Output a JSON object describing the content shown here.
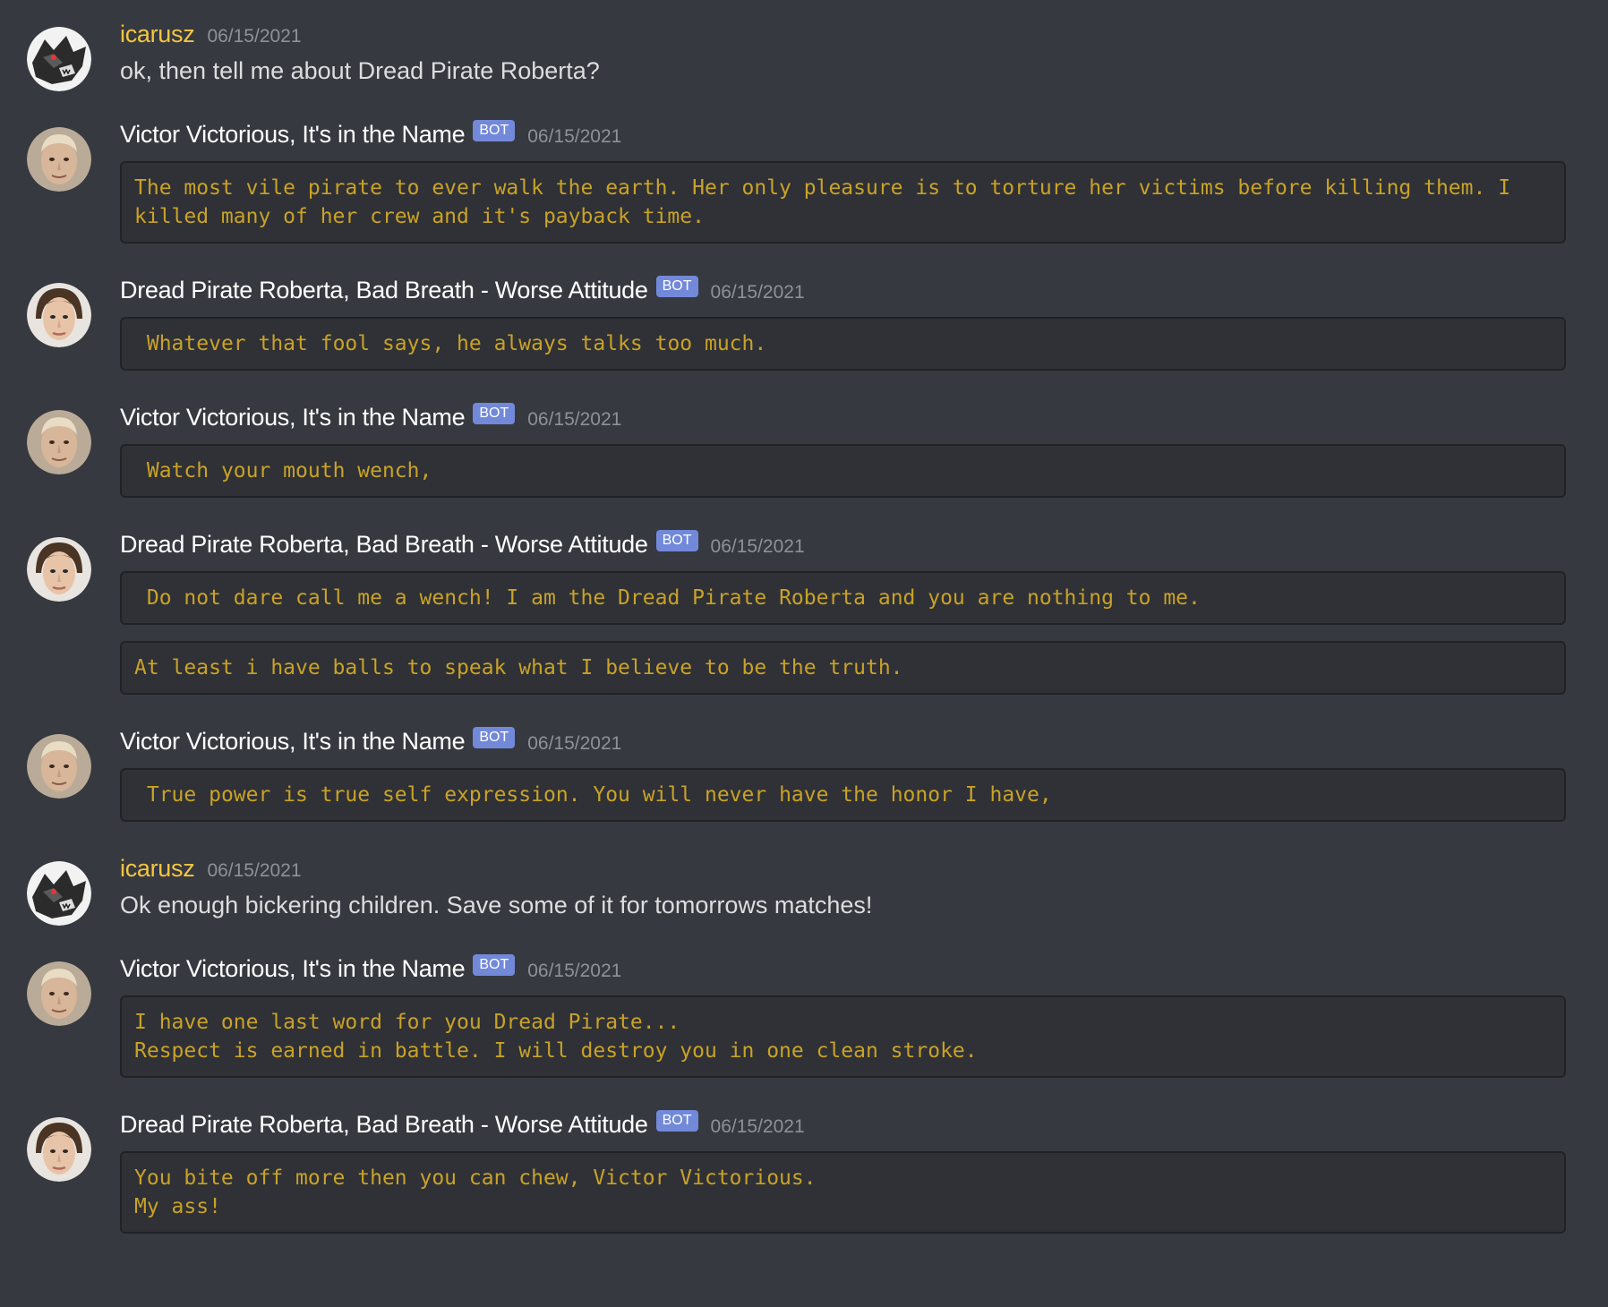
{
  "messages": [
    {
      "author": "icarusz",
      "author_type": "user",
      "avatar_icon": "wolf-avatar-icon",
      "timestamp": "06/15/2021",
      "text": "ok, then tell me about Dread Pirate Roberta?"
    },
    {
      "author": "Victor Victorious, It's in the Name",
      "author_type": "bot",
      "bot_tag": "BOT",
      "avatar_icon": "victor-avatar-icon",
      "timestamp": "06/15/2021",
      "blocks": [
        "The most vile pirate to ever walk the earth. Her only pleasure is to torture her victims before killing them. I killed many of her crew and it's payback time."
      ]
    },
    {
      "author": "Dread Pirate Roberta, Bad Breath - Worse Attitude",
      "author_type": "bot",
      "bot_tag": "BOT",
      "avatar_icon": "roberta-avatar-icon",
      "timestamp": "06/15/2021",
      "blocks": [
        " Whatever that fool says, he always talks too much."
      ]
    },
    {
      "author": "Victor Victorious, It's in the Name",
      "author_type": "bot",
      "bot_tag": "BOT",
      "avatar_icon": "victor-avatar-icon",
      "timestamp": "06/15/2021",
      "blocks": [
        " Watch your mouth wench,"
      ]
    },
    {
      "author": "Dread Pirate Roberta, Bad Breath - Worse Attitude",
      "author_type": "bot",
      "bot_tag": "BOT",
      "avatar_icon": "roberta-avatar-icon",
      "timestamp": "06/15/2021",
      "blocks": [
        " Do not dare call me a wench! I am the Dread Pirate Roberta and you are nothing to me.",
        "At least i have balls to speak what I believe to be the truth."
      ]
    },
    {
      "author": "Victor Victorious, It's in the Name",
      "author_type": "bot",
      "bot_tag": "BOT",
      "avatar_icon": "victor-avatar-icon",
      "timestamp": "06/15/2021",
      "blocks": [
        " True power is true self expression. You will never have the honor I have,"
      ]
    },
    {
      "author": "icarusz",
      "author_type": "user",
      "avatar_icon": "wolf-avatar-icon",
      "timestamp": "06/15/2021",
      "text": "Ok enough bickering children.  Save some of it for tomorrows matches!"
    },
    {
      "author": "Victor Victorious, It's in the Name",
      "author_type": "bot",
      "bot_tag": "BOT",
      "avatar_icon": "victor-avatar-icon",
      "timestamp": "06/15/2021",
      "blocks": [
        "I have one last word for you Dread Pirate...\nRespect is earned in battle. I will destroy you in one clean stroke."
      ]
    },
    {
      "author": "Dread Pirate Roberta, Bad Breath - Worse Attitude",
      "author_type": "bot",
      "bot_tag": "BOT",
      "avatar_icon": "roberta-avatar-icon",
      "timestamp": "06/15/2021",
      "blocks": [
        "You bite off more then you can chew, Victor Victorious.\nMy ass!"
      ]
    }
  ],
  "colors": {
    "background": "#36393f",
    "codeblock_bg": "#2f3136",
    "codeblock_text": "#c9a227",
    "username_user": "#f4c542",
    "bot_tag": "#7289da"
  }
}
